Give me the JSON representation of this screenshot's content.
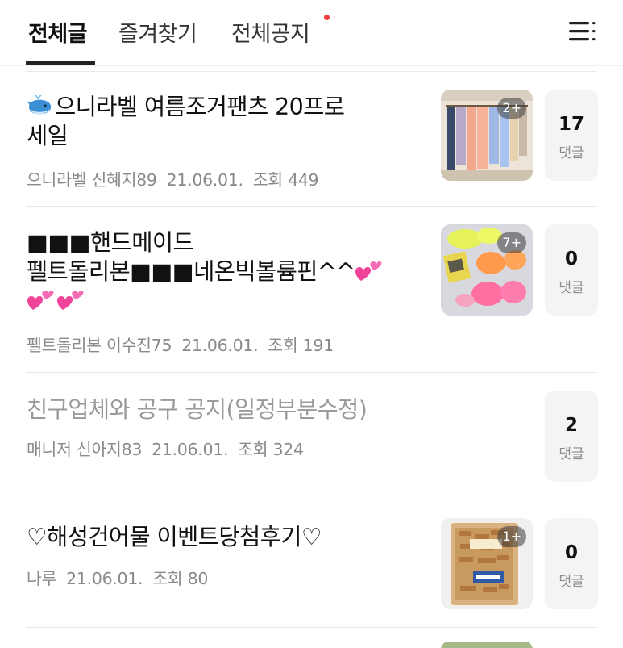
{
  "tabs": {
    "all": "전체글",
    "favorites": "즐겨찾기",
    "notice": "전체공지"
  },
  "icons": {
    "menu": "hamburger-list-icon",
    "emoji_whale": "whale-emoji",
    "emoji_hearts": "two-hearts-emoji"
  },
  "colors": {
    "accent_dot": "#ef3b3b",
    "active_tab": "#111111",
    "notice_title": "#9a9a9a",
    "comment_bg": "#f4f4f6"
  },
  "posts": [
    {
      "title_line1": "으니라벨 여름조거팬츠 20프로",
      "title_line2": "세일",
      "author": "으니라벨 신혜지89",
      "date": "21.06.01.",
      "views": "조회 449",
      "image_count": "2+",
      "comments": "17",
      "comment_label": "댓글"
    },
    {
      "title_line1": "■■■핸드메이드",
      "title_line2a": "펠트돌리본■■■네온빅볼륨핀^^",
      "title_line3": "",
      "author": "펠트돌리본 이수진75",
      "date": "21.06.01.",
      "views": "조회 191",
      "image_count": "7+",
      "comments": "0",
      "comment_label": "댓글"
    },
    {
      "title_line1": "친구업체와 공구 공지(일정부분수정)",
      "author": "매니저 신아지83",
      "date": "21.06.01.",
      "views": "조회 324",
      "comments": "2",
      "comment_label": "댓글"
    },
    {
      "title_line1": "♡해성건어물 이벤트당첨후기♡",
      "author": "나루",
      "date": "21.06.01.",
      "views": "조회 80",
      "image_count": "1+",
      "comments": "0",
      "comment_label": "댓글"
    }
  ]
}
